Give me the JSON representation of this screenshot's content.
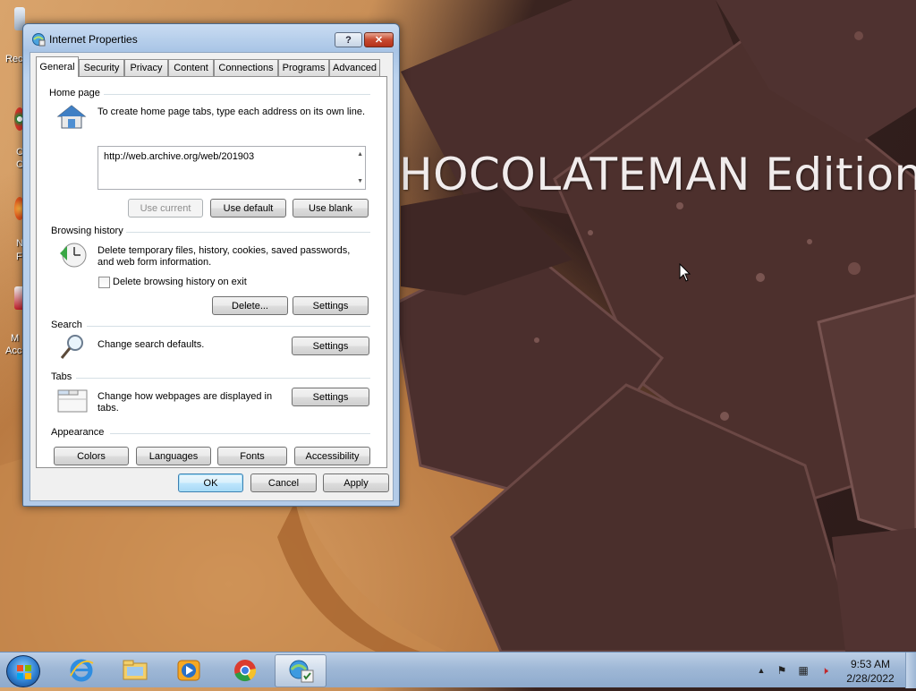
{
  "desktop": {
    "wallpaper_caption": "HOCOLATEMAN Edition",
    "icon_labels": [
      "Rec",
      "C",
      "C",
      "N",
      "F",
      "M",
      "Acc"
    ]
  },
  "dialog": {
    "title": "Internet Properties",
    "help_label": "?",
    "close_label": "✕",
    "tabs": [
      {
        "label": "General"
      },
      {
        "label": "Security"
      },
      {
        "label": "Privacy"
      },
      {
        "label": "Content"
      },
      {
        "label": "Connections"
      },
      {
        "label": "Programs"
      },
      {
        "label": "Advanced"
      }
    ],
    "home_page": {
      "group_title": "Home page",
      "instruction": "To create home page tabs, type each address on its own line.",
      "url_value": "http://web.archive.org/web/201903",
      "use_current": "Use current",
      "use_default": "Use default",
      "use_blank": "Use blank"
    },
    "browsing_history": {
      "group_title": "Browsing history",
      "description_line1": "Delete temporary files, history, cookies, saved passwords,",
      "description_line2": "and web form information.",
      "checkbox_label": "Delete browsing history on exit",
      "checkbox_checked": false,
      "delete_label": "Delete...",
      "settings_label": "Settings"
    },
    "search": {
      "group_title": "Search",
      "description": "Change search defaults.",
      "settings_label": "Settings"
    },
    "tabs_section": {
      "group_title": "Tabs",
      "description_line1": "Change how webpages are displayed in",
      "description_line2": "tabs.",
      "settings_label": "Settings"
    },
    "appearance": {
      "group_title": "Appearance",
      "colors": "Colors",
      "languages": "Languages",
      "fonts": "Fonts",
      "accessibility": "Accessibility"
    },
    "footer": {
      "ok": "OK",
      "cancel": "Cancel",
      "apply": "Apply"
    }
  },
  "taskbar": {
    "items": [
      {
        "name": "internet-explorer-icon"
      },
      {
        "name": "windows-explorer-icon"
      },
      {
        "name": "media-player-icon"
      },
      {
        "name": "chrome-icon"
      },
      {
        "name": "internet-properties-icon",
        "active": true
      }
    ],
    "clock_time": "9:53 AM",
    "clock_date": "2/28/2022"
  },
  "colors": {
    "accent": "#3c7fb1",
    "close_red": "#c7492f",
    "taskbar": "#9fb8d6"
  }
}
